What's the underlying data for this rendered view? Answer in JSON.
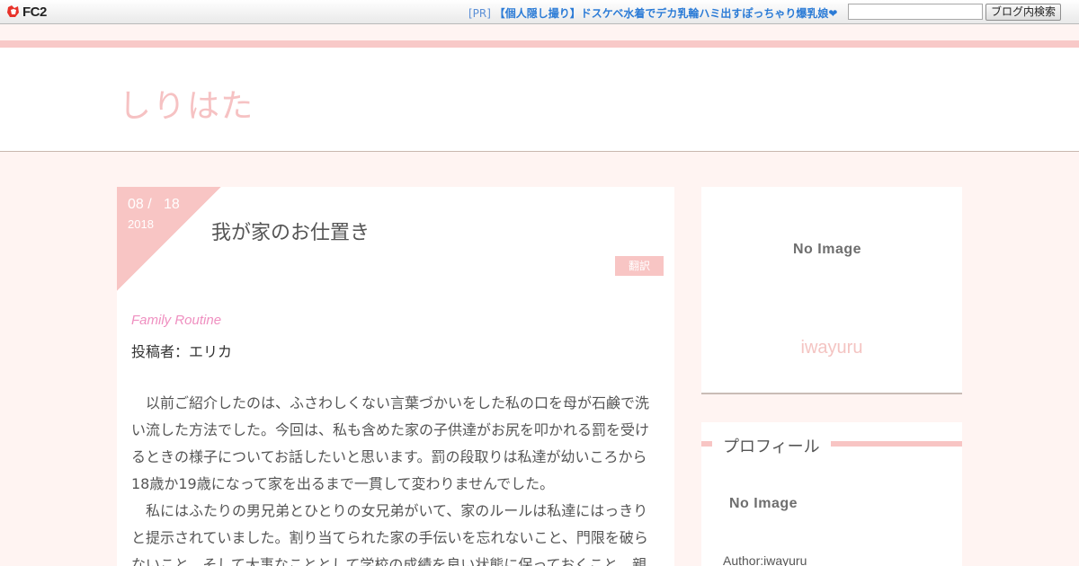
{
  "fc2bar": {
    "logo_text": "FC2",
    "logo_icon": "fc2-logo-icon",
    "pr_tag": "[PR]",
    "pr_link": "【個人隠し撮り】ドスケベ水着でデカ乳輪ハミ出すぽっちゃり爆乳娘❤",
    "search_value": "",
    "search_button": "ブログ内検索"
  },
  "header": {
    "blog_title": "しりはた"
  },
  "article": {
    "date_md": "08 /   18",
    "date_year": "2018",
    "title": "我が家のお仕置き",
    "category": "翻訳",
    "subtitle": "Family Routine",
    "author_line": "投稿者：エリカ",
    "paragraphs": [
      "以前ご紹介したのは、ふさわしくない言葉づかいをした私の口を母が石鹸で洗い流した方法でした。今回は、私も含めた家の子供達がお尻を叩かれる罰を受けるときの様子についてお話したいと思います。罰の段取りは私達が幼いころから18歳か19歳になって家を出るまで一貫して変わりませんでした。",
      "私にはふたりの男兄弟とひとりの女兄弟がいて、家のルールは私達にはっきりと提示されていました。割り当てられた家の手伝いを忘れないこと、門限を破らないこと、そして大事なこととして学校の成績を良い状態に保っておくこと。親"
    ]
  },
  "sidebar": {
    "top_image_text": "No Image",
    "top_name": "iwayuru",
    "profile_heading": "プロフィール",
    "profile_image_text": "No Image",
    "profile_author": "Author:iwayuru"
  },
  "colors": {
    "accent_pink": "#f8c5c4",
    "subtitle_pink": "#ef8fc0",
    "link_blue": "#2b7bd6"
  }
}
